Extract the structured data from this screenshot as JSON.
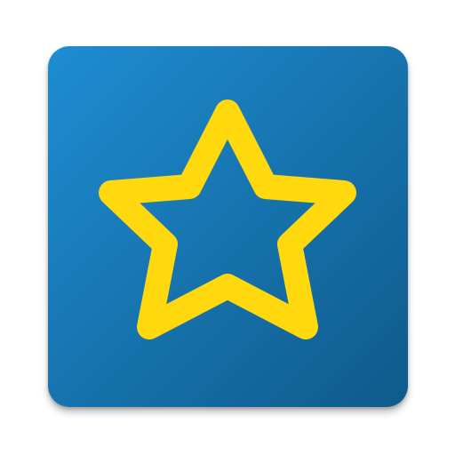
{
  "icon": {
    "name": "star-icon",
    "shape": "rounded-square",
    "colors": {
      "background_light": "#1E8DD2",
      "background_dark": "#0F5A8B",
      "star_stroke": "#FFD80E"
    }
  }
}
